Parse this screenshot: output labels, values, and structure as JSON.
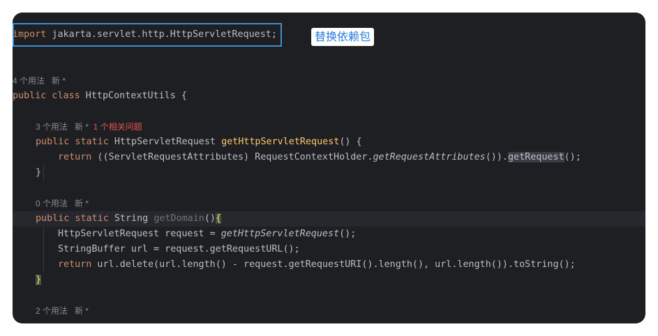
{
  "editor": {
    "import_kw": "import",
    "import_rest": " jakarta.servlet.http.HttpServletRequest;",
    "annotation": "替换依赖包",
    "class_hint": "4 个用法   新 *",
    "class_kw": "public class",
    "class_name": " HttpContextUtils {",
    "m1_hint": "3 个用法   新 *",
    "m1_warn": "1 个相关问题",
    "m1_kw": "public static",
    "m1_type": " HttpServletRequest ",
    "m1_name": "getHttpServletRequest",
    "m1_params": "() {",
    "m1_body_kw": "return",
    "m1_body_a": " ((ServletRequestAttributes) RequestContextHolder.",
    "m1_body_b": "getRequestAttributes",
    "m1_body_c": "()).",
    "m1_body_d": "getRequest",
    "m1_body_e": "();",
    "m1_close": "}",
    "m2_hint": "0 个用法   新 *",
    "m2_kw": "public static",
    "m2_type": " String ",
    "m2_name": "getDomain",
    "m2_paren": "()",
    "m2_brace": "{",
    "m2_l1_a": "HttpServletRequest request = ",
    "m2_l1_b": "getHttpServletRequest",
    "m2_l1_c": "();",
    "m2_l2": "StringBuffer url = request.getRequestURL();",
    "m2_l3_kw": "return",
    "m2_l3_a": " url.delete(url.length() - request.getRequestURI().length(), url.length()).toString();",
    "m2_close": "}",
    "m3_hint": "2 个用法   新 *"
  }
}
